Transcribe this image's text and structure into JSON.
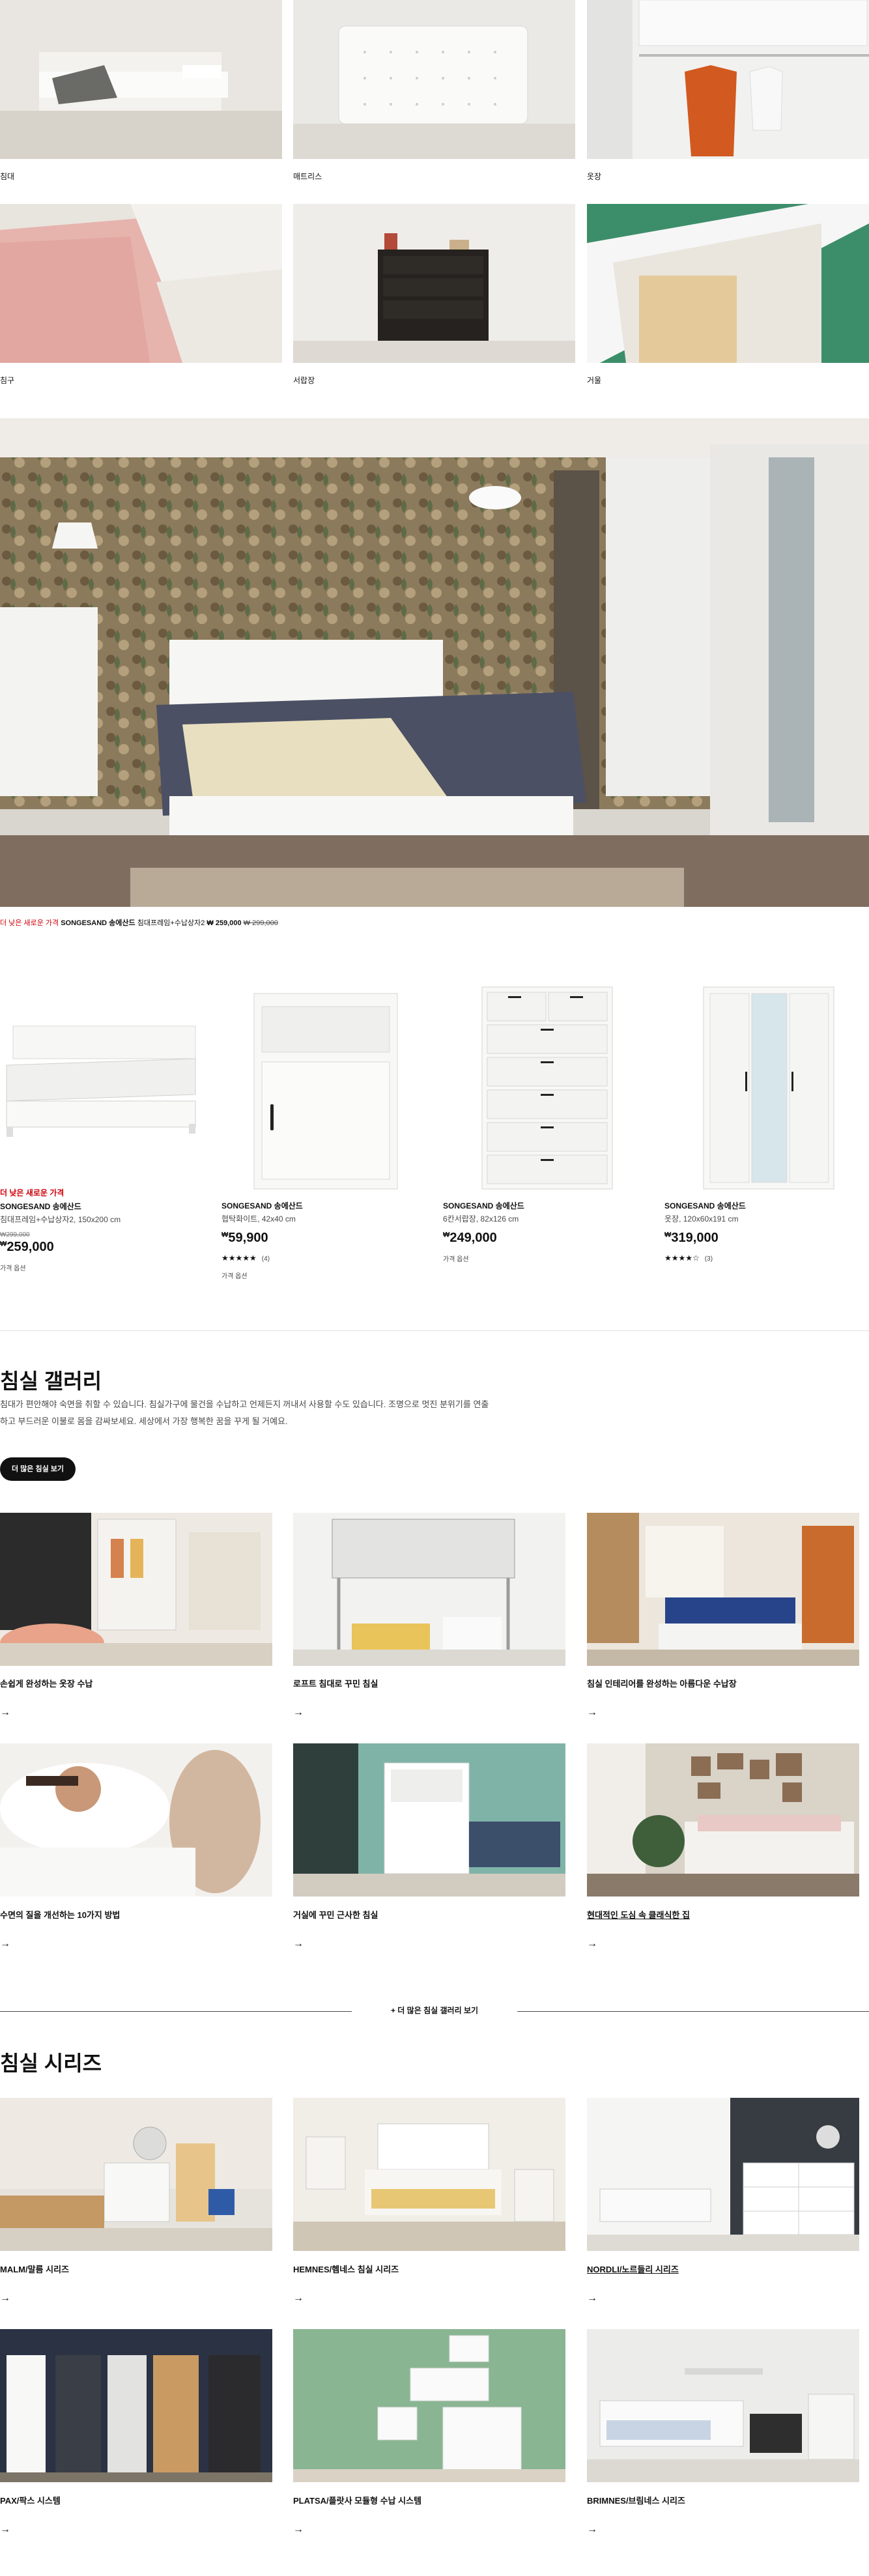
{
  "categories": [
    {
      "label": "침대",
      "image_icon": "bed-photo"
    },
    {
      "label": "매트리스",
      "image_icon": "mattress-photo"
    },
    {
      "label": "옷장",
      "image_icon": "wardrobe-photo"
    },
    {
      "label": "침구",
      "image_icon": "bedding-photo"
    },
    {
      "label": "서랍장",
      "image_icon": "chest-of-drawers-photo"
    },
    {
      "label": "거울",
      "image_icon": "mirror-photo"
    }
  ],
  "hero": {
    "badge": "더 낮은 새로운 가격",
    "name": "SONGESAND 송에산드",
    "desc": "침대프레임+수납상자2",
    "price": "₩ 259,000",
    "old_price": "₩ 299,000"
  },
  "products": [
    {
      "badge": "더 낮은 새로운 가격",
      "name": "SONGESAND 송에산드",
      "desc": "침대프레임+수납상자2, 150x200 cm",
      "old_price": "₩299,000",
      "currency": "₩",
      "price": "259,000",
      "stars": "",
      "review_count": "",
      "note": "가격 옵션"
    },
    {
      "badge": "",
      "name": "SONGESAND 송에산드",
      "desc": "협탁화이트, 42x40 cm",
      "old_price": "",
      "currency": "₩",
      "price": "59,900",
      "stars": "★★★★★",
      "review_count": "(4)",
      "note": "가격 옵션"
    },
    {
      "badge": "",
      "name": "SONGESAND 송에산드",
      "desc": "6칸서랍장, 82x126 cm",
      "old_price": "",
      "currency": "₩",
      "price": "249,000",
      "stars": "",
      "review_count": "",
      "note": "가격 옵션"
    },
    {
      "badge": "",
      "name": "SONGESAND 송에산드",
      "desc": "옷장, 120x60x191 cm",
      "old_price": "",
      "currency": "₩",
      "price": "319,000",
      "stars": "★★★★☆",
      "review_count": "(3)",
      "note": ""
    }
  ],
  "gallery": {
    "title": "침실 갤러리",
    "desc": "침대가 편안해야 숙면을 취할 수 있습니다. 침실가구에 물건을 수납하고 언제든지 꺼내서 사용할 수도 있습니다. 조명으로 멋진 분위기를 연출하고 부드러운 이불로 몸을 감싸보세요. 세상에서 가장 행복한 꿈을 꾸게 될 거예요.",
    "button": "더 많은 침실 보기",
    "cards": [
      {
        "title": "손쉽게 완성하는 옷장 수납"
      },
      {
        "title": "로프트 침대로 꾸민 침실"
      },
      {
        "title": "침실 인테리어를 완성하는 아름다운 수납장"
      },
      {
        "title": "수면의 질을 개선하는 10가지 방법"
      },
      {
        "title": "거실에 꾸민 근사한 침실"
      },
      {
        "title": "현대적인 도심 속 클래식한 집"
      }
    ],
    "more": "+ 더 많은 침실 갤러리 보기"
  },
  "series": {
    "title": "침실 시리즈",
    "cards": [
      {
        "title": "MALM/말름 시리즈"
      },
      {
        "title": "HEMNES/헴네스 침실 시리즈"
      },
      {
        "title": "NORDLI/노르들리 시리즈"
      },
      {
        "title": "PAX/팍스 시스템"
      },
      {
        "title": "PLATSA/플랏사 모듈형 수납 시스템"
      },
      {
        "title": "BRIMNES/브림네스 시리즈"
      }
    ]
  },
  "arrow": "→",
  "colors": {
    "accent_red": "#cc0008",
    "text": "#111111",
    "muted": "#484848"
  }
}
